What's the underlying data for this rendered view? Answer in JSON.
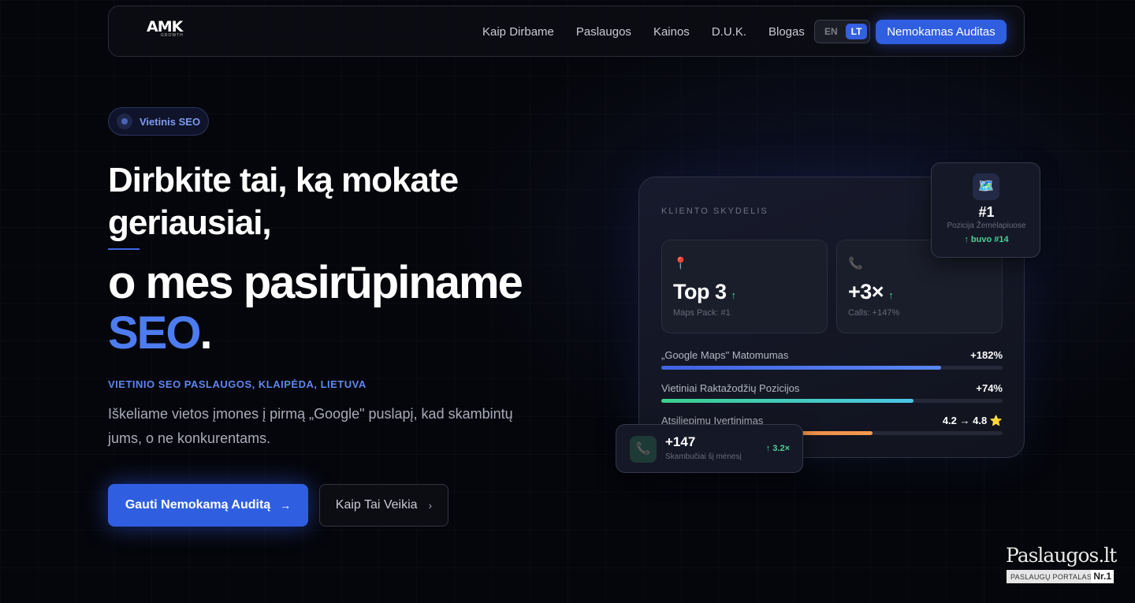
{
  "nav": {
    "logo_text": "AMK",
    "logo_sub": "GROWTH",
    "links": [
      "Kaip Dirbame",
      "Paslaugos",
      "Kainos",
      "D.U.K.",
      "Blogas"
    ],
    "lang_en": "EN",
    "lang_lt": "LT",
    "cta": "Nemokamas Auditas"
  },
  "hero": {
    "badge": "Vietinis SEO",
    "headline_1": "Dirbkite tai, ką mokate geriausiai,",
    "headline_2": "o mes pasirūpiname",
    "headline_3_accent": "SEO",
    "headline_3_end": ".",
    "subtag": "VIETINIO SEO PASLAUGOS, KLAIPĖDA, LIETUVA",
    "lead": "Iškeliame vietos įmones į pirmą „Google\" puslapį, kad skambintų jums, o ne konkurentams.",
    "btn_primary": "Gauti Nemokamą Auditą",
    "btn_secondary": "Kaip Tai Veikia"
  },
  "dashboard": {
    "title": "KLIENTO SKYDELIS",
    "stats": [
      {
        "icon": "pin-icon",
        "value": "Top 3",
        "sub": "Maps Pack: #1"
      },
      {
        "icon": "phone-icon",
        "value": "+3×",
        "sub": "Calls: +147%"
      }
    ],
    "bars": [
      {
        "label": "„Google Maps\" Matomumas",
        "value": "+182%",
        "fill": 0.82
      },
      {
        "label": "Vietiniai Raktažodžių Pozicijos",
        "value": "+74%",
        "fill": 0.74
      },
      {
        "label": "Atsiliepimų Įvertinimas",
        "value": "4.2 → 4.8 ⭐",
        "fill": 0.62
      }
    ]
  },
  "map_card": {
    "icon": "map-icon",
    "rank": "#1",
    "sub": "Pozicija Žemėlapiuose",
    "was": "↑ buvo #14"
  },
  "call_card": {
    "icon": "phone-icon",
    "number": "+147",
    "sub": "Skambučiai šį mėnesį",
    "growth": "↑ 3.2×"
  },
  "watermark": {
    "main": "Paslaugos.lt",
    "sub": "PASLAUGŲ PORTALAS",
    "nr": "Nr.1"
  },
  "colors": {
    "accent": "#2f5ee0",
    "accent_text": "#4d7cf0",
    "positive": "#4ad295",
    "background": "#05060b"
  }
}
